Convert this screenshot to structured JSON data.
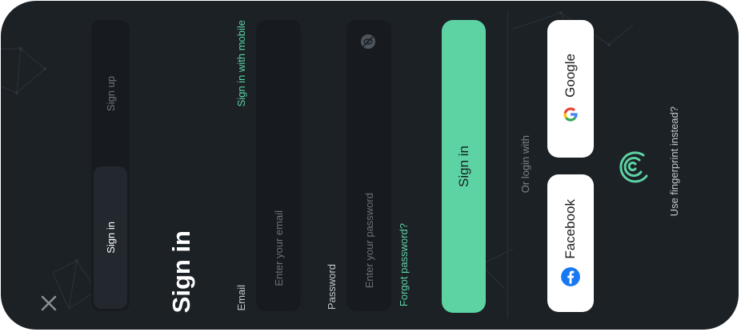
{
  "segmented": {
    "sign_in": "Sign in",
    "sign_up": "Sign up"
  },
  "page": {
    "title": "Sign in"
  },
  "email": {
    "label": "Email",
    "placeholder": "Enter your email",
    "mobile_link": "Sign in with mobile"
  },
  "password": {
    "label": "Password",
    "placeholder": "Enter your password",
    "forgot_link": "Forgot password?"
  },
  "actions": {
    "sign_in": "Sign in",
    "or_login": "Or login with"
  },
  "social": {
    "google": "Google",
    "facebook": "Facebook"
  },
  "fingerprint": {
    "text": "Use fingerprint instead?"
  },
  "icons": {
    "close": "close-icon",
    "eye": "eye-off-icon",
    "google": "google-icon",
    "facebook": "facebook-icon",
    "fingerprint": "fingerprint-icon"
  },
  "colors": {
    "background": "#1c2126",
    "field": "#171b20",
    "accent": "#5dd3a3",
    "text": "#ffffff",
    "muted": "#8a9199"
  }
}
